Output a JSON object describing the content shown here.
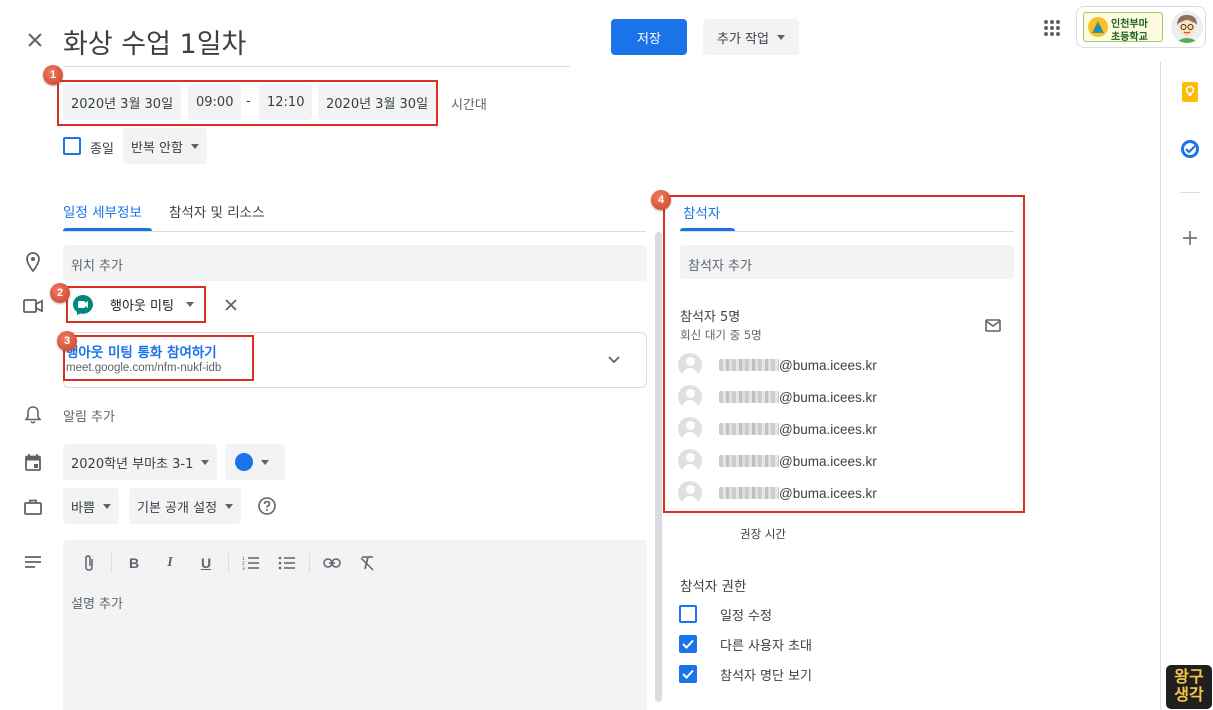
{
  "header": {
    "title": "화상 수업 1일차",
    "save_label": "저장",
    "more_actions_label": "추가 작업",
    "school_name_line1": "인천부마",
    "school_name_line2": "초등학교"
  },
  "datetime": {
    "start_date": "2020년 3월 30일",
    "start_time": "09:00",
    "separator": "-",
    "end_time": "12:10",
    "end_date": "2020년 3월 30일",
    "timezone_label": "시간대",
    "all_day_label": "종일",
    "repeat_label": "반복 안함"
  },
  "tabs": {
    "details": "일정 세부정보",
    "guests_resources": "참석자 및 리소스"
  },
  "details": {
    "location_placeholder": "위치 추가",
    "meet_label": "행아웃 미팅",
    "meet_join_label": "행아웃 미팅 통화 참여하기",
    "meet_url": "meet.google.com/nfm-nukf-idb",
    "notification_label": "알림 추가",
    "calendar_label": "2020학년 부마초 3-1",
    "calendar_color": "#1a73e8",
    "busy_label": "바쁨",
    "visibility_label": "기본 공개 설정",
    "description_placeholder": "설명 추가"
  },
  "guests": {
    "tab_label": "참석자",
    "add_placeholder": "참석자 추가",
    "count_label": "참석자 5명",
    "awaiting_label": "회신 대기 중 5명",
    "list": [
      {
        "email": "@buma.icees.kr"
      },
      {
        "email": "@buma.icees.kr"
      },
      {
        "email": "@buma.icees.kr"
      },
      {
        "email": "@buma.icees.kr"
      },
      {
        "email": "@buma.icees.kr"
      }
    ],
    "suggested_times_label": "권장 시간",
    "permissions_title": "참석자 권한",
    "permissions": [
      {
        "label": "일정 수정",
        "checked": false
      },
      {
        "label": "다른 사용자 초대",
        "checked": true
      },
      {
        "label": "참석자 명단 보기",
        "checked": true
      }
    ]
  },
  "annotations": {
    "b1": "1",
    "b2": "2",
    "b3": "3",
    "b4": "4"
  },
  "watermark": {
    "line1": "왕구",
    "line2": "생각"
  },
  "colors": {
    "accent": "#1a73e8",
    "annotation_red": "#d93025",
    "meet_green": "#00897b"
  }
}
